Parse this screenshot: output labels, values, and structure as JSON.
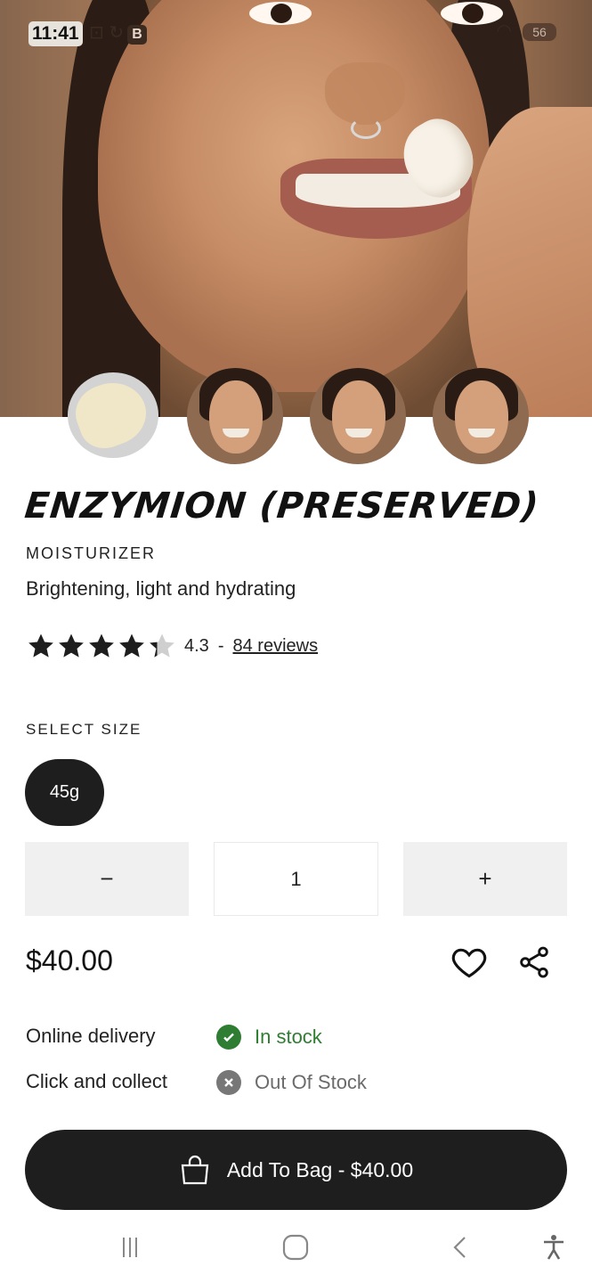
{
  "status_bar": {
    "time": "11:41",
    "battery": "56"
  },
  "product": {
    "name": "ENZYMION (PRESERVED)",
    "category": "MOISTURIZER",
    "tagline": "Brightening, light and hydrating",
    "rating": {
      "stars": 4.3,
      "value": "4.3",
      "separator": "-",
      "reviews_label": "84 reviews"
    },
    "size": {
      "label": "SELECT SIZE",
      "options": [
        "45g"
      ],
      "selected": "45g"
    },
    "quantity": {
      "minus": "−",
      "value": "1",
      "plus": "+"
    },
    "price": "$40.00"
  },
  "availability": [
    {
      "channel": "Online delivery",
      "status": "In stock",
      "status_color": "#2e7d32",
      "icon": "check-circle-icon"
    },
    {
      "channel": "Click and collect",
      "status": "Out Of Stock",
      "status_color": "#6b6b6b",
      "icon": "x-circle-icon"
    }
  ],
  "cta": {
    "label": "Add To Bag - $40.00",
    "icon": "shopping-bag-icon"
  },
  "colors": {
    "dark": "#1e1e1e",
    "in_stock": "#2e7d32",
    "star": "#1e1e1e",
    "star_empty": "#cfcfcf"
  }
}
